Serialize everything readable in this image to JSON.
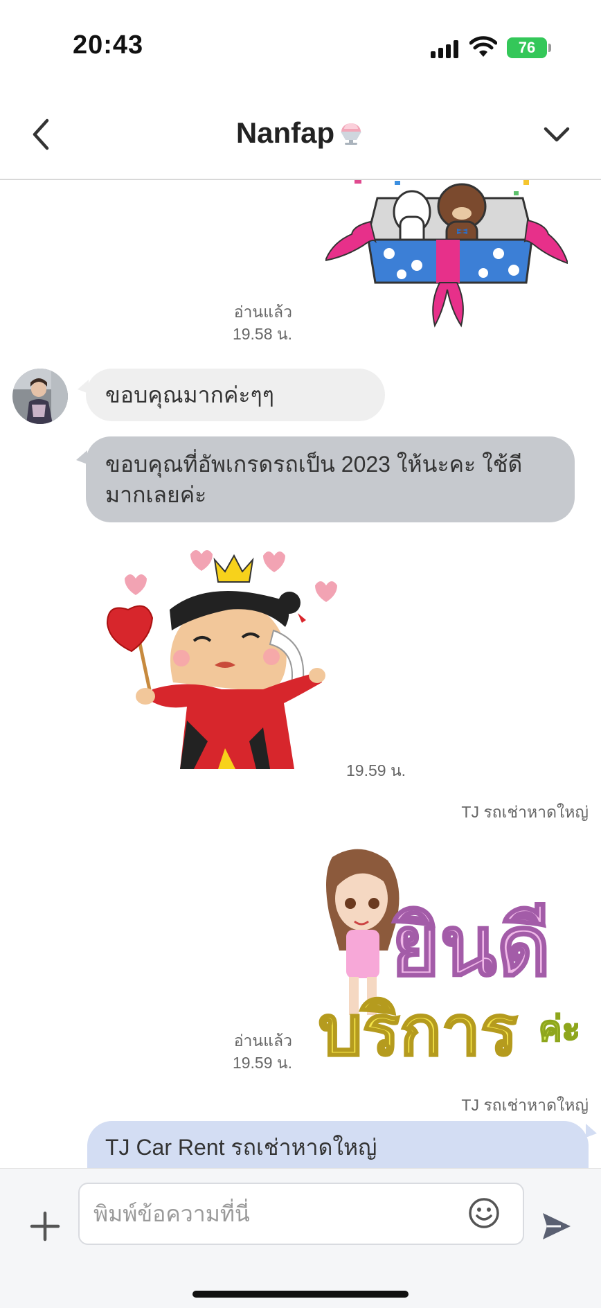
{
  "status_bar": {
    "time": "20:43",
    "battery": "76"
  },
  "header": {
    "title": "Nanfap"
  },
  "messages": {
    "m1_read": "อ่านแล้ว",
    "m1_time": "19.58 น.",
    "m2_text": "ขอบคุณมากค่ะๆๆ",
    "m3_text": "ขอบคุณที่อัพเกรดรถเป็น 2023 ให้นะคะ ใช้ดีมากเลยค่ะ",
    "m4_time": "19.59 น.",
    "m5_sender": "TJ รถเช่าหาดใหญ่",
    "m5_read": "อ่านแล้ว",
    "m5_time": "19.59 น.",
    "m5_sticker_text_top": "ยินดี",
    "m5_sticker_text_bottom": "บริการ",
    "m5_sticker_text_suffix": "ค่ะ",
    "m6_sender": "TJ รถเช่าหาดใหญ่",
    "m6_text": "TJ Car Rent รถเช่าหาดใหญ่"
  },
  "composer": {
    "placeholder": "พิมพ์ข้อความที่นี่"
  },
  "icons": {
    "back": "chevron-left-icon",
    "menu": "chevron-down-icon",
    "add": "plus-icon",
    "emoji": "smile-icon",
    "send": "send-icon"
  },
  "colors": {
    "bubble_incoming": "#efefef",
    "bubble_grey": "#c6c9ce",
    "bubble_outgoing": "#d3ddf3",
    "battery": "#34c759"
  }
}
